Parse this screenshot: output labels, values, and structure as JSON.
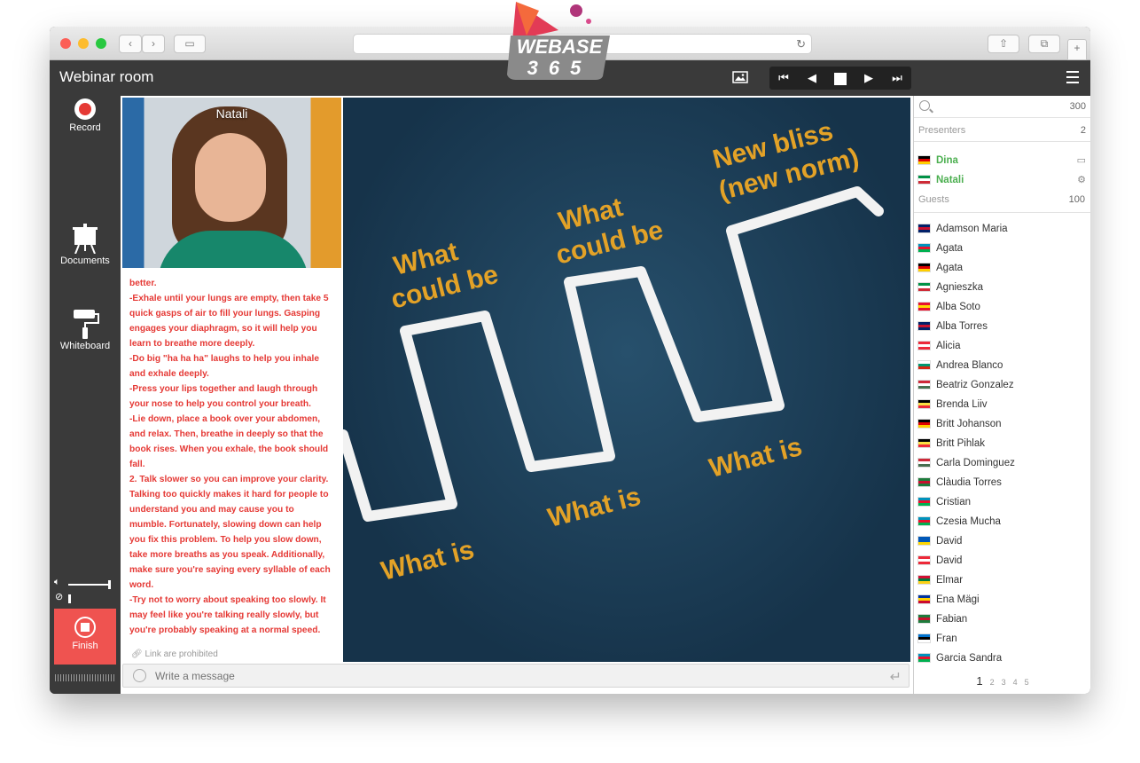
{
  "browser": {
    "url": ""
  },
  "logo": {
    "line1": "WEBASE",
    "line2": "365"
  },
  "app": {
    "title": "Webinar room"
  },
  "toolbar": {
    "image_icon": "image-icon",
    "player": [
      "skip-back-icon",
      "prev-icon",
      "stop-icon",
      "next-icon",
      "skip-forward-icon"
    ],
    "menu_icon": "hamburger-icon"
  },
  "sidebar": {
    "record_label": "Record",
    "documents_label": "Documents",
    "whiteboard_label": "Whiteboard",
    "finish_label": "Finish"
  },
  "video": {
    "name": "Natali"
  },
  "chat": {
    "lines": [
      "better.",
      "-Exhale until your lungs are empty, then take 5",
      "quick gasps of air to fill your lungs. Gasping",
      "engages your diaphragm, so it will help you",
      "learn to breathe more deeply.",
      "-Do big \"ha ha ha\" laughs to help you inhale",
      "and exhale deeply.",
      "-Press your lips together and laugh through",
      "your nose to help you control your breath.",
      "-Lie down, place a book over your abdomen,",
      "and relax. Then, breathe in deeply so that the",
      "book rises. When you exhale, the book should",
      "fall.",
      "2. Talk slower so you can improve your clarity.",
      "Talking too quickly makes it hard for people to",
      "understand you and may cause you to",
      "mumble. Fortunately, slowing down can help",
      "you fix this problem. To help you slow down,",
      "take more breaths as you speak. Additionally,",
      "make sure you're saying every syllable of each",
      "word.",
      "-Try not to worry about speaking too slowly. It",
      "may feel like you're talking really slowly, but",
      "you're probably speaking at a normal speed."
    ],
    "links_note": "Link are prohibited",
    "message_placeholder": "Write a message"
  },
  "slide": {
    "what_could_be_1": [
      "What",
      "could be"
    ],
    "what_could_be_2": [
      "What",
      "could be"
    ],
    "new_bliss": [
      "New bliss",
      "(new norm)"
    ],
    "what_is_1": "What is",
    "what_is_2": "What is",
    "what_is_3": "What is"
  },
  "participants": {
    "total": "300",
    "presenters_label": "Presenters",
    "presenters_count": "2",
    "presenters": [
      {
        "name": "Dina",
        "flag": [
          "#000000",
          "#dd0000",
          "#ffce00"
        ],
        "icon": "screen-icon"
      },
      {
        "name": "Natali",
        "flag": [
          "#009246",
          "#ffffff",
          "#ce2b37"
        ],
        "icon": "gear-icon"
      }
    ],
    "guests_label": "Guests",
    "guests_count": "100",
    "guests": [
      {
        "name": "Adamson Maria",
        "flag": [
          "#012169",
          "#c8102e",
          "#012169"
        ]
      },
      {
        "name": "Agata",
        "flag": [
          "#0092bc",
          "#e8112d",
          "#00b050"
        ]
      },
      {
        "name": "Agata",
        "flag": [
          "#000000",
          "#dd0000",
          "#ffce00"
        ]
      },
      {
        "name": "Agnieszka",
        "flag": [
          "#009246",
          "#ffffff",
          "#ce2b37"
        ]
      },
      {
        "name": "Alba Soto",
        "flag": [
          "#e8112d",
          "#ffd700",
          "#e8112d"
        ]
      },
      {
        "name": "Alba Torres",
        "flag": [
          "#012169",
          "#c8102e",
          "#012169"
        ]
      },
      {
        "name": "Alicia",
        "flag": [
          "#ed2939",
          "#ffffff",
          "#ed2939"
        ]
      },
      {
        "name": "Andrea Blanco",
        "flag": [
          "#ffffff",
          "#00966e",
          "#d62612"
        ]
      },
      {
        "name": "Beatriz Gonzalez",
        "flag": [
          "#ce2939",
          "#ffffff",
          "#477050"
        ]
      },
      {
        "name": "Brenda Liiv",
        "flag": [
          "#000000",
          "#fae042",
          "#ed2939"
        ]
      },
      {
        "name": "Britt Johanson",
        "flag": [
          "#000000",
          "#dd0000",
          "#ffce00"
        ]
      },
      {
        "name": "Britt Pihlak",
        "flag": [
          "#000000",
          "#fae042",
          "#ed2939"
        ]
      },
      {
        "name": "Carla Dominguez",
        "flag": [
          "#ce2939",
          "#ffffff",
          "#477050"
        ]
      },
      {
        "name": "Clàudia Torres",
        "flag": [
          "#1e7b3c",
          "#c8102e",
          "#1e7b3c"
        ]
      },
      {
        "name": "Cristian",
        "flag": [
          "#0092bc",
          "#e8112d",
          "#00b050"
        ]
      },
      {
        "name": "Czesia Mucha",
        "flag": [
          "#0092bc",
          "#e8112d",
          "#00b050"
        ]
      },
      {
        "name": "David",
        "flag": [
          "#0057b7",
          "#0057b7",
          "#ffd700"
        ]
      },
      {
        "name": "David",
        "flag": [
          "#ed2939",
          "#ffffff",
          "#ed2939"
        ]
      },
      {
        "name": "Elmar",
        "flag": [
          "#d21034",
          "#007a3d",
          "#fcd116"
        ]
      },
      {
        "name": "Ena Mägi",
        "flag": [
          "#0033a0",
          "#ffd100",
          "#cc092f"
        ]
      },
      {
        "name": "Fabian",
        "flag": [
          "#1e7b3c",
          "#c8102e",
          "#1e7b3c"
        ]
      },
      {
        "name": "Fran",
        "flag": [
          "#0072ce",
          "#000000",
          "#ffffff"
        ]
      },
      {
        "name": "Garcia Sandra",
        "flag": [
          "#0092bc",
          "#e8112d",
          "#00b050"
        ]
      }
    ],
    "pages": [
      "1",
      "2",
      "3",
      "4",
      "5"
    ],
    "current_page": "1"
  }
}
